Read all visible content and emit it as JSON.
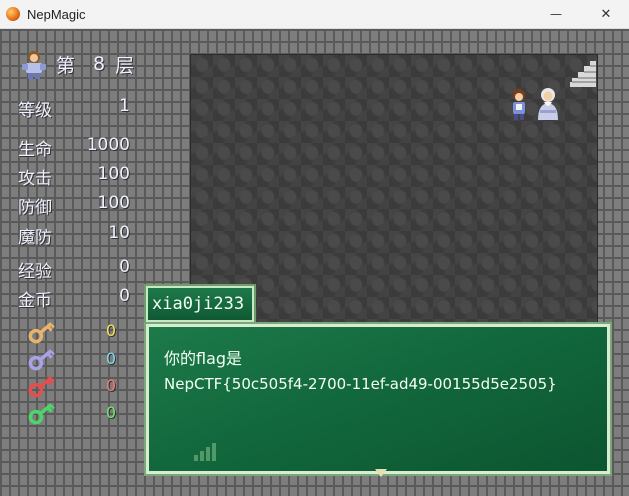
{
  "window": {
    "title": "NepMagic",
    "minimize_glyph": "—",
    "close_glyph": "✕"
  },
  "sidebar": {
    "floor": {
      "label": "第",
      "number": "8",
      "suffix": "层"
    },
    "stats": [
      {
        "label": "等级",
        "value": "1"
      },
      {
        "label": "生命",
        "value": "1000"
      },
      {
        "label": "攻击",
        "value": "100"
      },
      {
        "label": "防御",
        "value": "100"
      },
      {
        "label": "魔防",
        "value": "10"
      },
      {
        "label": "经验",
        "value": "0"
      },
      {
        "label": "金币",
        "value": "0"
      }
    ],
    "keys": [
      {
        "icon": "yellow-key-icon",
        "color": "#e8b36a",
        "count": "0",
        "count_color": "#f3e25a"
      },
      {
        "icon": "blue-key-icon",
        "color": "#a8a2e6",
        "count": "0",
        "count_color": "#7fd8e8"
      },
      {
        "icon": "red-key-icon",
        "color": "#e84c4c",
        "count": "0",
        "count_color": "#f27b73"
      },
      {
        "icon": "green-key-icon",
        "color": "#4cd66a",
        "count": "0",
        "count_color": "#6ee86e"
      }
    ]
  },
  "dialog": {
    "speaker": "xia0ji233",
    "line1": "你的flag是",
    "line2": "NepCTF{50c505f4-2700-11ef-ad49-00155d5e2505}"
  }
}
